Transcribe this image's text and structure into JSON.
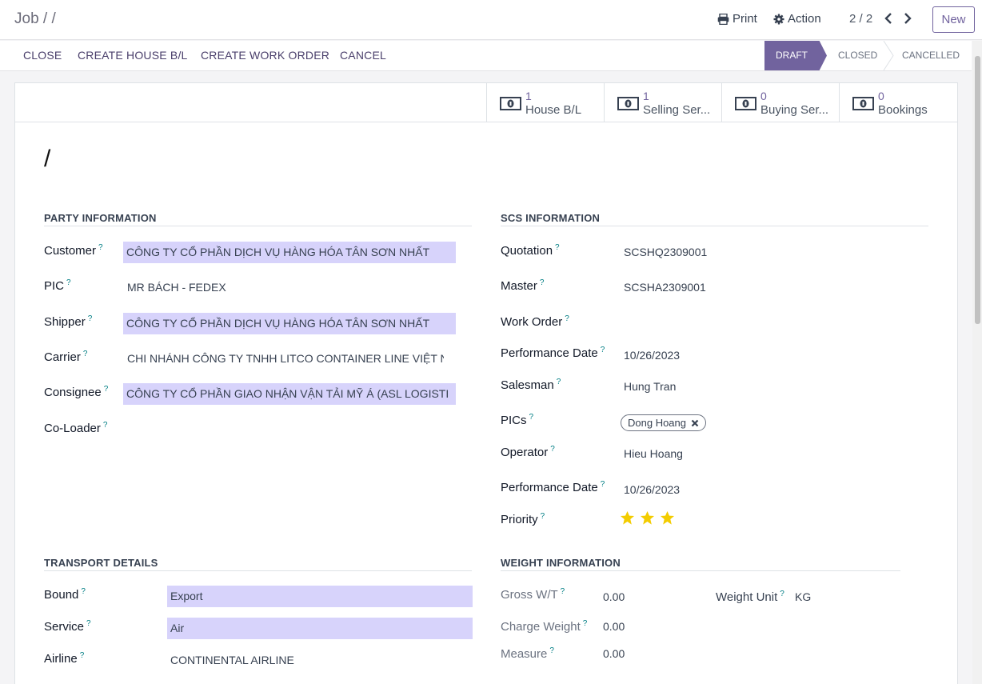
{
  "breadcrumb": "Job / /",
  "top": {
    "print_label": "Print",
    "action_label": "Action",
    "pager": "2 / 2",
    "new_label": "New"
  },
  "buttons": {
    "close": "CLOSE",
    "create_house_bl": "CREATE HOUSE B/L",
    "create_work_order": "CREATE WORK ORDER",
    "cancel": "CANCEL"
  },
  "status": {
    "stages": [
      "DRAFT",
      "CLOSED",
      "CANCELLED"
    ],
    "active": "DRAFT"
  },
  "smart_buttons": [
    {
      "count": "1",
      "label": "House B/L",
      "icon": "money-icon"
    },
    {
      "count": "1",
      "label": "Selling Ser...",
      "icon": "money-icon"
    },
    {
      "count": "0",
      "label": "Buying Ser...",
      "icon": "money-icon"
    },
    {
      "count": "0",
      "label": "Bookings",
      "icon": "money-icon"
    }
  ],
  "record_title": "/",
  "party": {
    "heading": "PARTY INFORMATION",
    "customer_label": "Customer",
    "customer": "CÔNG TY CỔ PHẦN DỊCH VỤ HÀNG HÓA TÂN SƠN NHẤT",
    "pic_label": "PIC",
    "pic": "MR BÁCH - FEDEX",
    "shipper_label": "Shipper",
    "shipper": "CÔNG TY CỔ PHẦN DỊCH VỤ HÀNG HÓA TÂN SƠN NHẤT",
    "carrier_label": "Carrier",
    "carrier": "CHI NHÁNH CÔNG TY TNHH LITCO CONTAINER LINE VIỆT NA",
    "consignee_label": "Consignee",
    "consignee": "CÔNG TY CỔ PHẦN GIAO NHẬN VẬN TẢI MỸ Á (ASL LOGISTI",
    "coloader_label": "Co-Loader"
  },
  "scs": {
    "heading": "SCS INFORMATION",
    "quotation_label": "Quotation",
    "quotation": "SCSHQ2309001",
    "master_label": "Master",
    "master": "SCSHA2309001",
    "work_order_label": "Work Order",
    "performance_date_label": "Performance Date",
    "performance_date": "10/26/2023",
    "salesman_label": "Salesman",
    "salesman": "Hung Tran",
    "pics_label": "PICs",
    "pics_tag": "Dong Hoang",
    "operator_label": "Operator",
    "operator": "Hieu Hoang",
    "performance_date2_label": "Performance Date",
    "performance_date2": "10/26/2023",
    "priority_label": "Priority",
    "priority_stars": 3
  },
  "transport": {
    "heading": "TRANSPORT DETAILS",
    "bound_label": "Bound",
    "bound": "Export",
    "service_label": "Service",
    "service": "Air",
    "airline_label": "Airline",
    "airline": "CONTINENTAL AIRLINE"
  },
  "weight": {
    "heading": "WEIGHT INFORMATION",
    "gross_label": "Gross W/T",
    "gross": "0.00",
    "unit_label": "Weight Unit",
    "unit": "KG",
    "charge_label": "Charge Weight",
    "charge": "0.00",
    "measure_label": "Measure",
    "measure": "0.00"
  },
  "colors": {
    "primary": "#71639e",
    "highlight": "#d7d3fb",
    "star": "#f3cc00",
    "help": "#017e84"
  }
}
